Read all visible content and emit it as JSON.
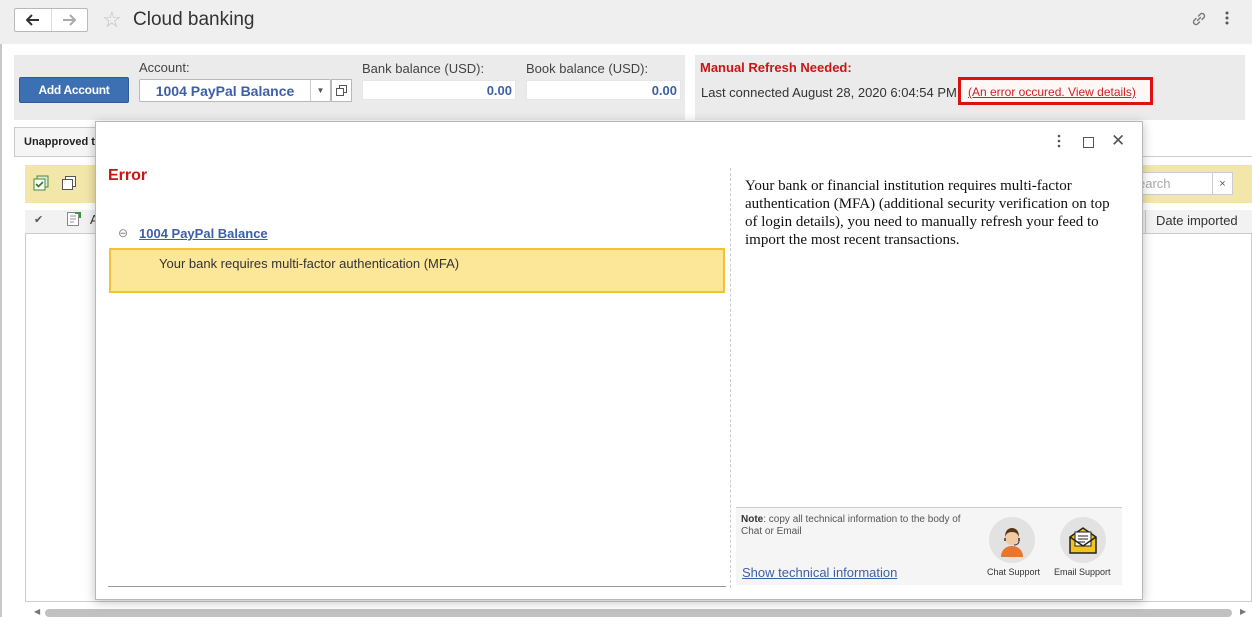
{
  "header": {
    "title": "Cloud banking",
    "back_icon": "arrow-left-icon",
    "forward_icon": "arrow-right-icon",
    "star_icon": "star-icon",
    "link_icon": "link-icon",
    "more_icon": "more-vertical-icon"
  },
  "toolbar": {
    "add_account_label": "Add Account",
    "account_label": "Account:",
    "account_value": "1004 PayPal Balance",
    "bank_balance_label": "Bank balance (USD):",
    "bank_balance_value": "0.00",
    "book_balance_label": "Book balance (USD):",
    "book_balance_value": "0.00"
  },
  "status": {
    "manual_refresh": "Manual Refresh Needed:",
    "last_connected": "Last connected August 28, 2020 6:04:54 PM",
    "error_link": "(An error occured. View details)",
    "error_color": "#cc1414"
  },
  "background": {
    "tab_label": "Unapproved tra",
    "search_placeholder": "earch",
    "search_clear": "×",
    "col_a": "A",
    "col_date_imported": "Date imported"
  },
  "modal": {
    "title": "Error",
    "account_link": "1004 PayPal Balance",
    "warning_text": "Your bank requires multi-factor authentication (MFA)",
    "warning_bg": "#fce698",
    "message": "Your bank or financial institution requires multi-factor authentication (MFA) (additional security verification on top of login details), you need to manually refresh your feed to import the most recent transactions.",
    "note_bold": "Note",
    "note_rest": ": copy all technical information to the body of Chat or Email",
    "tech_link": "Show technical information",
    "chat_label": "Chat Support",
    "email_label": "Email Support"
  }
}
